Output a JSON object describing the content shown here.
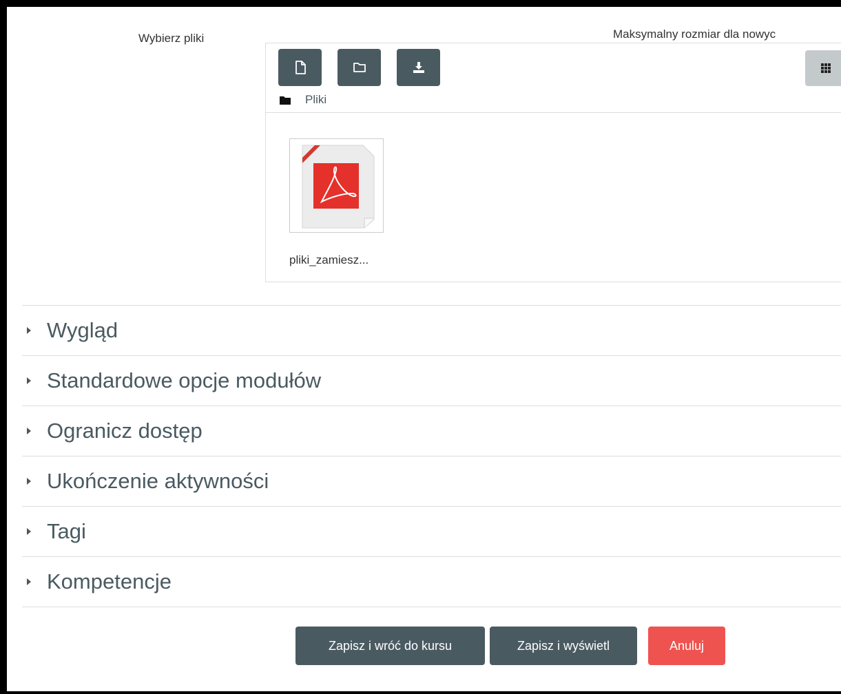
{
  "filepicker": {
    "label": "Wybierz pliki",
    "max_size_text": "Maksymalny rozmiar dla nowyc",
    "toolbar": {
      "add_file_icon": "file-icon",
      "new_folder_icon": "folder-icon",
      "download_icon": "download-icon",
      "view_icon": "grid-icon"
    },
    "path": {
      "folder_label": "Pliki"
    },
    "files": [
      {
        "name": "pliki_zamiesz...",
        "icon": "pdf-file-icon"
      }
    ]
  },
  "sections": [
    {
      "title": "Wygląd"
    },
    {
      "title": "Standardowe opcje modułów"
    },
    {
      "title": "Ogranicz dostęp"
    },
    {
      "title": "Ukończenie aktywności"
    },
    {
      "title": "Tagi"
    },
    {
      "title": "Kompetencje"
    }
  ],
  "buttons": {
    "save_return": "Zapisz i wróć do kursu",
    "save_display": "Zapisz i wyświetl",
    "cancel": "Anuluj"
  },
  "colors": {
    "dark_button": "#4a5a61",
    "cancel_button": "#ef5350",
    "pdf_red": "#e5312b"
  }
}
